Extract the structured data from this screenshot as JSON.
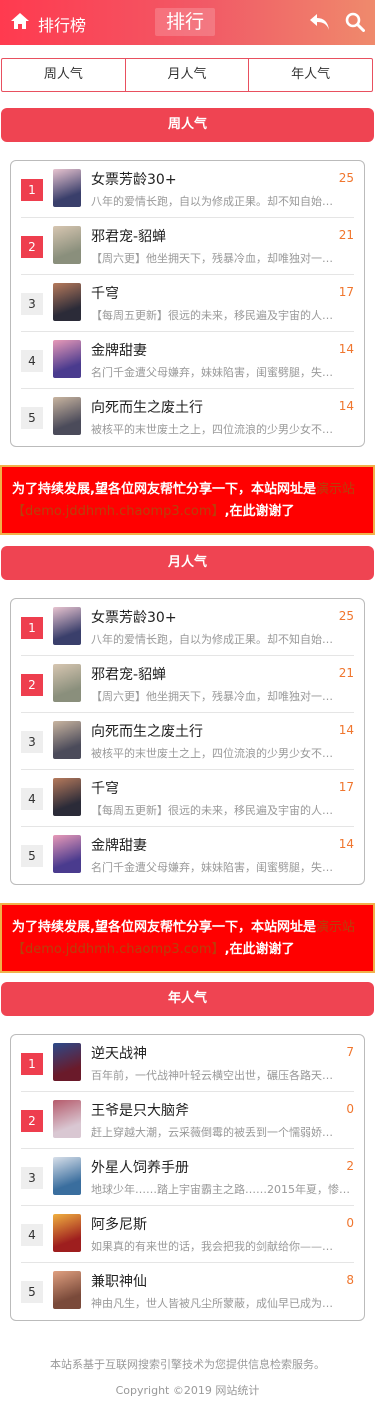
{
  "header": {
    "brand": "排行榜",
    "center_title": "排行"
  },
  "tabs": [
    "周人气",
    "月人气",
    "年人气"
  ],
  "sections": [
    {
      "title": "周人气",
      "items": [
        {
          "rank": "1",
          "title": "女票芳龄30+",
          "count": "25",
          "desc": "八年的爱情长跑，自以为修成正果。却不知自始…",
          "c1": "#3a3f6b",
          "c2": "#e8c4d0"
        },
        {
          "rank": "2",
          "title": "邪君宠-貂蝉",
          "count": "21",
          "desc": "【周六更】他坐拥天下，残暴冷血，却唯独对一…",
          "c1": "#8a8f7c",
          "c2": "#d7c6b1"
        },
        {
          "rank": "3",
          "title": "千穹",
          "count": "17",
          "desc": "【每周五更新】很远的未来，移民遍及宇宙的人…",
          "c1": "#2b2b38",
          "c2": "#b67a5c"
        },
        {
          "rank": "4",
          "title": "金牌甜妻",
          "count": "14",
          "desc": "名门千金遭父母嫌弃，妹妹陷害，闺蜜劈腿，失…",
          "c1": "#4a3b8e",
          "c2": "#e89ab8"
        },
        {
          "rank": "5",
          "title": "向死而生之废土行",
          "count": "14",
          "desc": "被核平的末世废土之上，四位流浪的少男少女不…",
          "c1": "#4b4b5a",
          "c2": "#c9b5a0"
        }
      ]
    },
    {
      "title": "月人气",
      "items": [
        {
          "rank": "1",
          "title": "女票芳龄30+",
          "count": "25",
          "desc": "八年的爱情长跑，自以为修成正果。却不知自始…",
          "c1": "#3a3f6b",
          "c2": "#e8c4d0"
        },
        {
          "rank": "2",
          "title": "邪君宠-貂蝉",
          "count": "21",
          "desc": "【周六更】他坐拥天下，残暴冷血，却唯独对一…",
          "c1": "#8a8f7c",
          "c2": "#d7c6b1"
        },
        {
          "rank": "3",
          "title": "向死而生之废土行",
          "count": "14",
          "desc": "被核平的末世废土之上，四位流浪的少男少女不…",
          "c1": "#4b4b5a",
          "c2": "#c9b5a0"
        },
        {
          "rank": "4",
          "title": "千穹",
          "count": "17",
          "desc": "【每周五更新】很远的未来，移民遍及宇宙的人…",
          "c1": "#2b2b38",
          "c2": "#b67a5c"
        },
        {
          "rank": "5",
          "title": "金牌甜妻",
          "count": "14",
          "desc": "名门千金遭父母嫌弃，妹妹陷害，闺蜜劈腿，失…",
          "c1": "#4a3b8e",
          "c2": "#e89ab8"
        }
      ]
    },
    {
      "title": "年人气",
      "items": [
        {
          "rank": "1",
          "title": "逆天战神",
          "count": "7",
          "desc": "百年前，一代战神叶轻云横空出世，碾压各路天…",
          "c1": "#6a1a2a",
          "c2": "#2c4a8a"
        },
        {
          "rank": "2",
          "title": "王爷是只大脑斧",
          "count": "0",
          "desc": "赶上穿越大潮，云采薇倒霉的被丢到一个懦弱娇…",
          "c1": "#d9c7d2",
          "c2": "#b55a6b"
        },
        {
          "rank": "3",
          "title": "外星人饲养手册",
          "count": "2",
          "desc": "地球少年……踏上宇宙霸主之路……2015年夏，惨…",
          "c1": "#3a6e9e",
          "c2": "#d8e0ea"
        },
        {
          "rank": "4",
          "title": "阿多尼斯",
          "count": "0",
          "desc": "如果真的有来世的话，我会把我的剑献给你——…",
          "c1": "#9e1e1e",
          "c2": "#f0b040"
        },
        {
          "rank": "5",
          "title": "兼职神仙",
          "count": "8",
          "desc": "神由凡生，世人皆被凡尘所蒙蔽，成仙早已成为…",
          "c1": "#7a4a3a",
          "c2": "#e0a080"
        }
      ]
    }
  ],
  "notice": {
    "text": "为了持续发展,望各位网友帮忙分享一下，本站网址是",
    "url": "演示站【demo.jddhmh.chaomp3.com】",
    "tail": ",在此谢谢了"
  },
  "footer": {
    "line1": "本站系基于互联网搜索引擎技术为您提供信息检索服务。",
    "line2": "Copyright ©2019 网站统计"
  }
}
